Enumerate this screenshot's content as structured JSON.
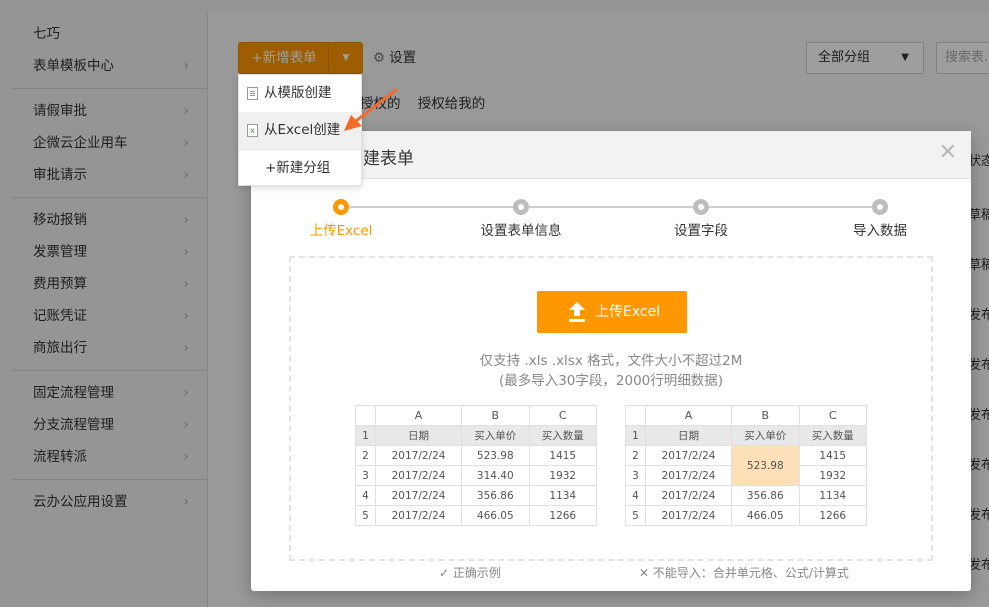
{
  "sidebar": {
    "sections": [
      [
        {
          "label": "七巧"
        },
        {
          "label": "表单模板中心"
        }
      ],
      [
        {
          "label": "请假审批"
        },
        {
          "label": "企微云企业用车"
        },
        {
          "label": "审批请示"
        }
      ],
      [
        {
          "label": "移动报销"
        },
        {
          "label": "发票管理"
        },
        {
          "label": "费用预算"
        },
        {
          "label": "记账凭证"
        },
        {
          "label": "商旅出行"
        }
      ],
      [
        {
          "label": "固定流程管理"
        },
        {
          "label": "分支流程管理"
        },
        {
          "label": "流程转派"
        }
      ],
      [
        {
          "label": "云办公应用设置"
        }
      ]
    ]
  },
  "toolbar": {
    "new_form_label": "+新增表单",
    "settings_label": "设置",
    "group_select_value": "全部分组",
    "search_placeholder": "搜索表..."
  },
  "tabs": [
    "授权的",
    "授权给我的"
  ],
  "dropdown": {
    "items": [
      {
        "label": "从模版创建"
      },
      {
        "label": "从Excel创建"
      },
      {
        "label": "+新建分组"
      }
    ]
  },
  "right_column": {
    "header": "状态",
    "values": [
      "草稿",
      "草稿",
      "发布",
      "发布",
      "发布",
      "发布",
      "发布",
      "发布"
    ]
  },
  "modal": {
    "title": "建表单",
    "steps": [
      {
        "label": "上传Excel",
        "active": true
      },
      {
        "label": "设置表单信息",
        "active": false
      },
      {
        "label": "设置字段",
        "active": false
      },
      {
        "label": "导入数据",
        "active": false
      }
    ],
    "upload_button": "上传Excel",
    "hint_line1": "仅支持 .xls .xlsx 格式，文件大小不超过2M",
    "hint_line2": "(最多导入30字段，2000行明细数据)",
    "example_tables": [
      {
        "caption": "正确示例",
        "caption_icon": "check-icon",
        "columns": [
          "A",
          "B",
          "C"
        ],
        "rows": [
          [
            "1",
            "日期",
            "买入单价",
            "买入数量"
          ],
          [
            "2",
            "2017/2/24",
            "523.98",
            "1415"
          ],
          [
            "3",
            "2017/2/24",
            "314.40",
            "1932"
          ],
          [
            "4",
            "2017/2/24",
            "356.86",
            "1134"
          ],
          [
            "5",
            "2017/2/24",
            "466.05",
            "1266"
          ]
        ]
      },
      {
        "caption": "不能导入：合并单元格、公式/计算式",
        "caption_icon": "cross-icon",
        "columns": [
          "A",
          "B",
          "C"
        ],
        "rows": [
          [
            "1",
            "日期",
            "买入单价",
            "买入数量"
          ],
          [
            "2",
            "2017/2/24",
            "523.98",
            "1415"
          ],
          [
            "3",
            "2017/2/24",
            "",
            "1932"
          ],
          [
            "4",
            "2017/2/24",
            "356.86",
            "1134"
          ],
          [
            "5",
            "2017/2/24",
            "466.05",
            "1266"
          ]
        ]
      }
    ]
  },
  "colors": {
    "accent": "#ff9800",
    "merged_cell": "#fde0b8"
  }
}
